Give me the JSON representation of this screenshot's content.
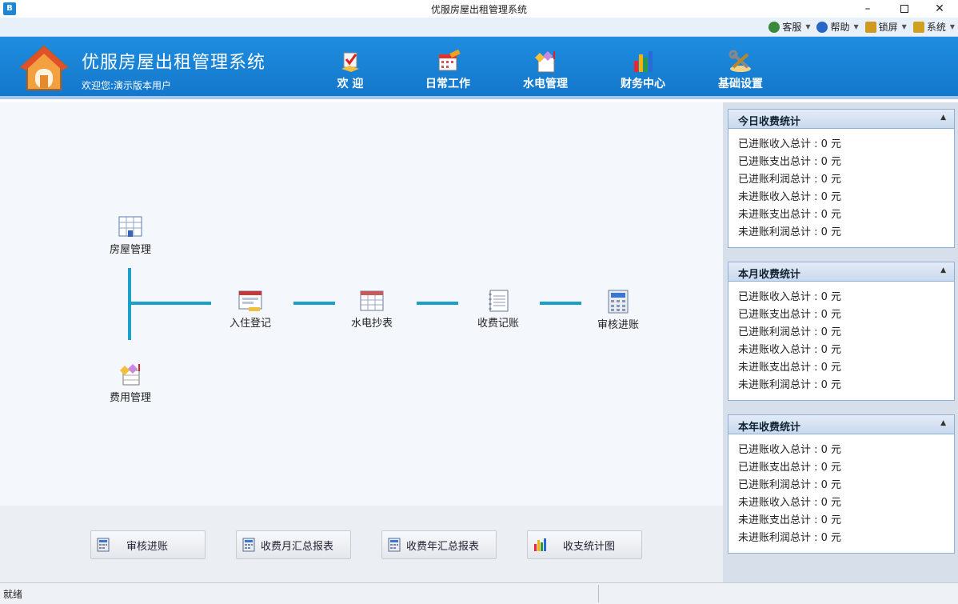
{
  "window": {
    "title": "优服房屋出租管理系统"
  },
  "toolbar": {
    "items": [
      {
        "label": "客服",
        "color": "#3a8a3a"
      },
      {
        "label": "帮助",
        "color": "#2a66c8"
      },
      {
        "label": "锁屏",
        "color": "#d09a20"
      },
      {
        "label": "系统",
        "color": "#d0a020"
      }
    ]
  },
  "header": {
    "app_title": "优服房屋出租管理系统",
    "welcome": "欢迎您:演示版本用户",
    "nav": [
      {
        "label": "欢 迎"
      },
      {
        "label": "日常工作"
      },
      {
        "label": "水电管理"
      },
      {
        "label": "财务中心"
      },
      {
        "label": "基础设置"
      }
    ]
  },
  "flow": {
    "nodes": {
      "house": "房屋管理",
      "fee": "费用管理",
      "checkin": "入住登记",
      "meter": "水电抄表",
      "charge": "收费记账",
      "audit": "审核进账"
    }
  },
  "reports": [
    {
      "label": "审核进账"
    },
    {
      "label": "收费月汇总报表"
    },
    {
      "label": "收费年汇总报表"
    },
    {
      "label": "收支统计图"
    }
  ],
  "panels": [
    {
      "title": "今日收费统计",
      "rows": [
        "已进账收入总计 : 0 元",
        "已进账支出总计 : 0 元",
        "已进账利润总计 : 0 元",
        "未进账收入总计 : 0 元",
        "未进账支出总计 : 0 元",
        "未进账利润总计 : 0 元"
      ]
    },
    {
      "title": "本月收费统计",
      "rows": [
        "已进账收入总计 : 0 元",
        "已进账支出总计 : 0 元",
        "已进账利润总计 : 0 元",
        "未进账收入总计 : 0 元",
        "未进账支出总计 : 0 元",
        "未进账利润总计 : 0 元"
      ]
    },
    {
      "title": "本年收费统计",
      "rows": [
        "已进账收入总计 : 0 元",
        "已进账支出总计 : 0 元",
        "已进账利润总计 : 0 元",
        "未进账收入总计 : 0 元",
        "未进账支出总计 : 0 元",
        "未进账利润总计 : 0 元"
      ]
    }
  ],
  "status": {
    "text": "就绪"
  }
}
